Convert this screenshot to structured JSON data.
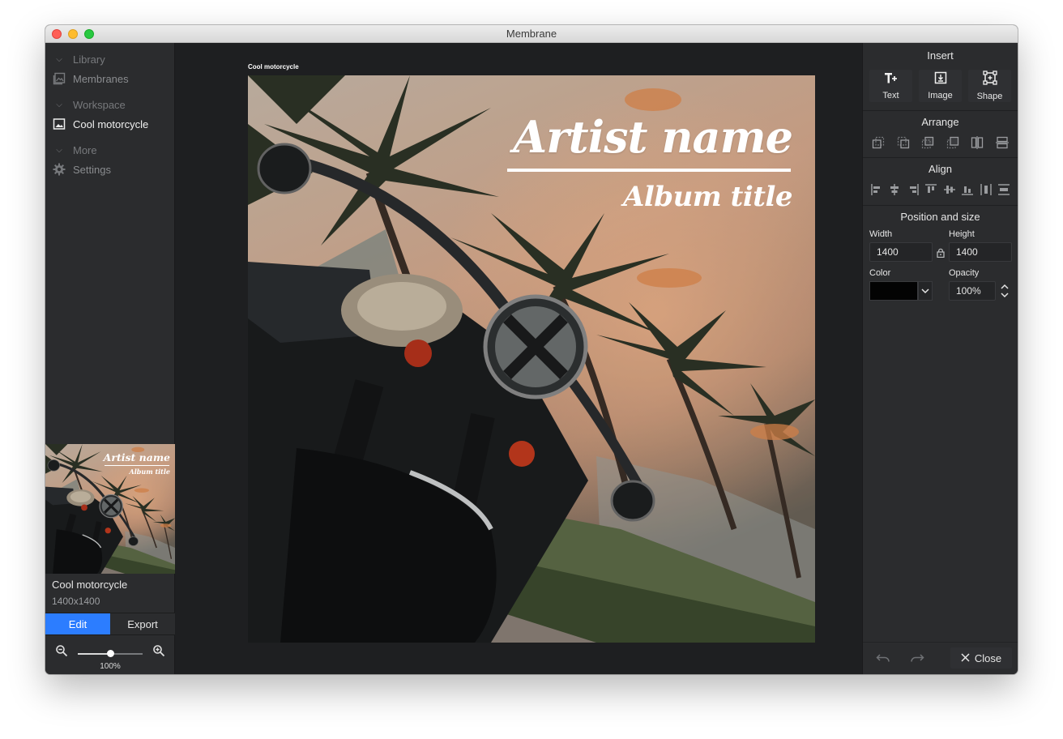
{
  "window": {
    "title": "Membrane"
  },
  "sidebar": {
    "sections": [
      {
        "label": "Library",
        "items": [
          {
            "label": "Membranes",
            "icon": "image-gallery-icon"
          }
        ]
      },
      {
        "label": "Workspace",
        "items": [
          {
            "label": "Cool motorcycle",
            "icon": "image-icon",
            "active": true
          }
        ]
      },
      {
        "label": "More",
        "items": [
          {
            "label": "Settings",
            "icon": "gear-icon"
          }
        ]
      }
    ],
    "thumbnail": {
      "artist": "Artist name",
      "album": "Album title"
    },
    "project": {
      "title": "Cool motorcycle",
      "size": "1400x1400"
    },
    "tabs": [
      {
        "label": "Edit",
        "active": true
      },
      {
        "label": "Export"
      }
    ],
    "zoom": {
      "value": "100%",
      "fraction": 0.5
    }
  },
  "canvas": {
    "label": "Cool motorcycle",
    "artist": "Artist name",
    "album": "Album title"
  },
  "panel": {
    "insert": {
      "title": "Insert",
      "buttons": [
        {
          "label": "Text"
        },
        {
          "label": "Image"
        },
        {
          "label": "Shape"
        }
      ]
    },
    "arrange": {
      "title": "Arrange"
    },
    "align": {
      "title": "Align"
    },
    "position": {
      "title": "Position and size",
      "width_label": "Width",
      "width_value": "1400",
      "height_label": "Height",
      "height_value": "1400",
      "color_label": "Color",
      "color_value": "#030303",
      "opacity_label": "Opacity",
      "opacity_value": "100%"
    },
    "close_label": "Close"
  },
  "colors": {
    "accent": "#2c7dff",
    "sidebar_bg": "#2b2c2e",
    "canvas_bg": "#1e1f21"
  }
}
